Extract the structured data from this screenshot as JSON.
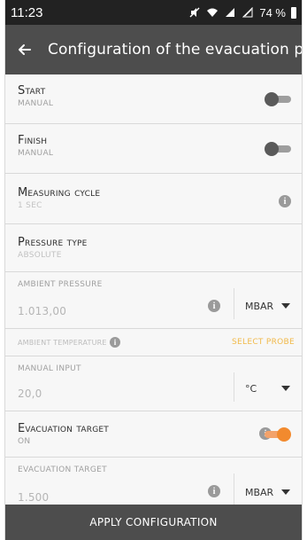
{
  "status_bar": {
    "time": "11:23",
    "battery_percent": "74 %",
    "icons": [
      "mute-icon",
      "wifi-icon",
      "signal-icon",
      "signal-icon-2",
      "battery-icon"
    ]
  },
  "app_bar": {
    "back_icon": "arrow-left-icon",
    "title": "Configuration of the evacuation process"
  },
  "settings": {
    "start": {
      "label": "Start",
      "value": "Manual",
      "toggle_on": false
    },
    "finish": {
      "label": "Finish",
      "value": "Manual",
      "toggle_on": false
    },
    "measuring_cycle": {
      "label": "Measuring cycle",
      "value": "1 Sec"
    },
    "pressure_type": {
      "label": "Pressure type",
      "value": "Absolute"
    },
    "ambient_pressure": {
      "label": "Ambient pressure",
      "value": "1.013,00",
      "unit": "mbar"
    },
    "probe": {
      "label": "Ambient temperature",
      "action": "Select probe"
    },
    "manual_input": {
      "label": "Manual input",
      "value": "20,0",
      "unit": "°C"
    },
    "evacuation_target_toggle": {
      "label": "Evacuation target",
      "value": "On",
      "toggle_on": true
    },
    "evacuation_target_value": {
      "label": "Evacuation target",
      "value": "1.500",
      "unit": "mbar"
    }
  },
  "footer": {
    "apply_label": "APPLY CONFIGURATION"
  },
  "colors": {
    "status_bar": "#222222",
    "app_bar": "#4d4d4d",
    "accent_orange": "#f28a2e",
    "probe_yellow": "#f1b94a",
    "background": "#f7f7f7"
  }
}
